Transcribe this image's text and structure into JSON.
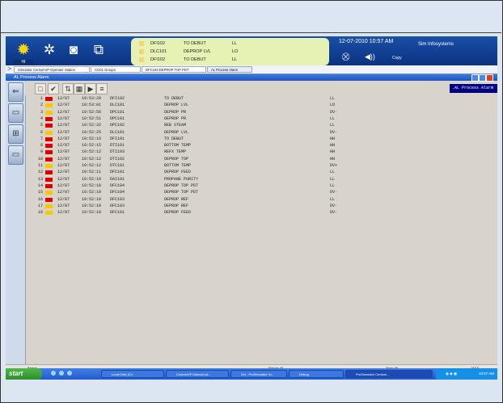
{
  "header": {
    "sun_label": "HI",
    "messages": [
      {
        "tag": "DFI102",
        "desc": "TO DEBUT",
        "cond": "LL"
      },
      {
        "tag": "DLC101",
        "desc": "DEPROP LVL",
        "cond": "LO"
      },
      {
        "tag": "DFI102",
        "desc": "TO DEBUT",
        "cond": "LL"
      }
    ],
    "datetime": "12-07-2010 10:57 AM",
    "vendor": "Sim Infosystems",
    "copy_label": "Copy"
  },
  "tabs": [
    "Simulator CentumVP Operator Station",
    "CG01 Group1",
    "DFC104:DEPROP TOP PDT",
    "AL Process Alarm"
  ],
  "window": {
    "title": "AL Process Alarm",
    "panel_label": ".AL Process Alarm"
  },
  "alarms": [
    {
      "num": "1",
      "color": "#e00000",
      "date": "12/07",
      "time": "10:53:29",
      "tag": "DFI102",
      "desc": "TO DEBUT",
      "cond": "LL"
    },
    {
      "num": "2",
      "color": "#f5c800",
      "date": "12/07",
      "time": "10:53:01",
      "tag": "DLC101",
      "desc": "DEPROP LVL",
      "cond": "LO"
    },
    {
      "num": "3",
      "color": "#f5c800",
      "date": "12/07",
      "time": "10:52:56",
      "tag": "DPC101",
      "desc": "DEPROP PR",
      "cond": "DV-"
    },
    {
      "num": "4",
      "color": "#e00000",
      "date": "12/07",
      "time": "10:52:51",
      "tag": "DPC101",
      "desc": "DEPROP PR",
      "cond": "LL"
    },
    {
      "num": "5",
      "color": "#e00000",
      "date": "12/07",
      "time": "10:52:32",
      "tag": "DPC102",
      "desc": "REB STEAM",
      "cond": "LL"
    },
    {
      "num": "6",
      "color": "#f5c800",
      "date": "12/07",
      "time": "10:52:25",
      "tag": "DLC101",
      "desc": "DEPROP LVL",
      "cond": "DV-"
    },
    {
      "num": "7",
      "color": "#e00000",
      "date": "12/07",
      "time": "10:52:16",
      "tag": "DFI101",
      "desc": "TO DEBUT",
      "cond": "HH"
    },
    {
      "num": "8",
      "color": "#e00000",
      "date": "12/07",
      "time": "10:52:15",
      "tag": "DTI101",
      "desc": "BOTTOM TEMP",
      "cond": "HH"
    },
    {
      "num": "9",
      "color": "#e00000",
      "date": "12/07",
      "time": "10:52:12",
      "tag": "DTI103",
      "desc": "REFX TEMP",
      "cond": "HH"
    },
    {
      "num": "10",
      "color": "#e00000",
      "date": "12/07",
      "time": "10:52:12",
      "tag": "DTI102",
      "desc": "DEPROP TOP",
      "cond": "HH"
    },
    {
      "num": "11",
      "color": "#f5c800",
      "date": "12/07",
      "time": "10:52:12",
      "tag": "DTC101",
      "desc": "BOTTOM TEMP",
      "cond": "DV+"
    },
    {
      "num": "12",
      "color": "#e00000",
      "date": "12/07",
      "time": "10:52:11",
      "tag": "DFC101",
      "desc": "DEPROP FEED",
      "cond": "LL"
    },
    {
      "num": "13",
      "color": "#e00000",
      "date": "12/07",
      "time": "10:52:10",
      "tag": "DAI101",
      "desc": "PROPANE PURITY",
      "cond": "LL"
    },
    {
      "num": "14",
      "color": "#e00000",
      "date": "12/07",
      "time": "10:52:10",
      "tag": "DFC104",
      "desc": "DEPROP TOP PDT",
      "cond": "LL"
    },
    {
      "num": "15",
      "color": "#f5c800",
      "date": "12/07",
      "time": "10:52:10",
      "tag": "DFC104",
      "desc": "DEPROP TOP PDT",
      "cond": "DV-"
    },
    {
      "num": "16",
      "color": "#e00000",
      "date": "12/07",
      "time": "10:52:10",
      "tag": "DFC103",
      "desc": "DEPROP REF",
      "cond": "LL"
    },
    {
      "num": "17",
      "color": "#f5c800",
      "date": "12/07",
      "time": "10:52:10",
      "tag": "DFC103",
      "desc": "DEPROP REF",
      "cond": "DV-"
    },
    {
      "num": "18",
      "color": "#f5c800",
      "date": "12/07",
      "time": "10:52:10",
      "tag": "DFC101",
      "desc": "DEPROP FEED",
      "cond": "DV-"
    }
  ],
  "statusbar": {
    "left": "Ready",
    "middle": "Range: All",
    "right": "Type: All",
    "count": "18/18"
  },
  "taskbar": {
    "start": "start",
    "tasks": [
      "Local Disk (D:)",
      "CentumVP Manual.od...",
      "Dvt - ProSimulator Dr...",
      "Debug",
      "ProSimulator Centum..."
    ],
    "clock": "10:57 AM"
  },
  "colors": {
    "alarm_red": "#e00000",
    "alarm_yellow": "#f5c800",
    "panel_blue": "#000080",
    "title_blue": "#1e56bd"
  }
}
